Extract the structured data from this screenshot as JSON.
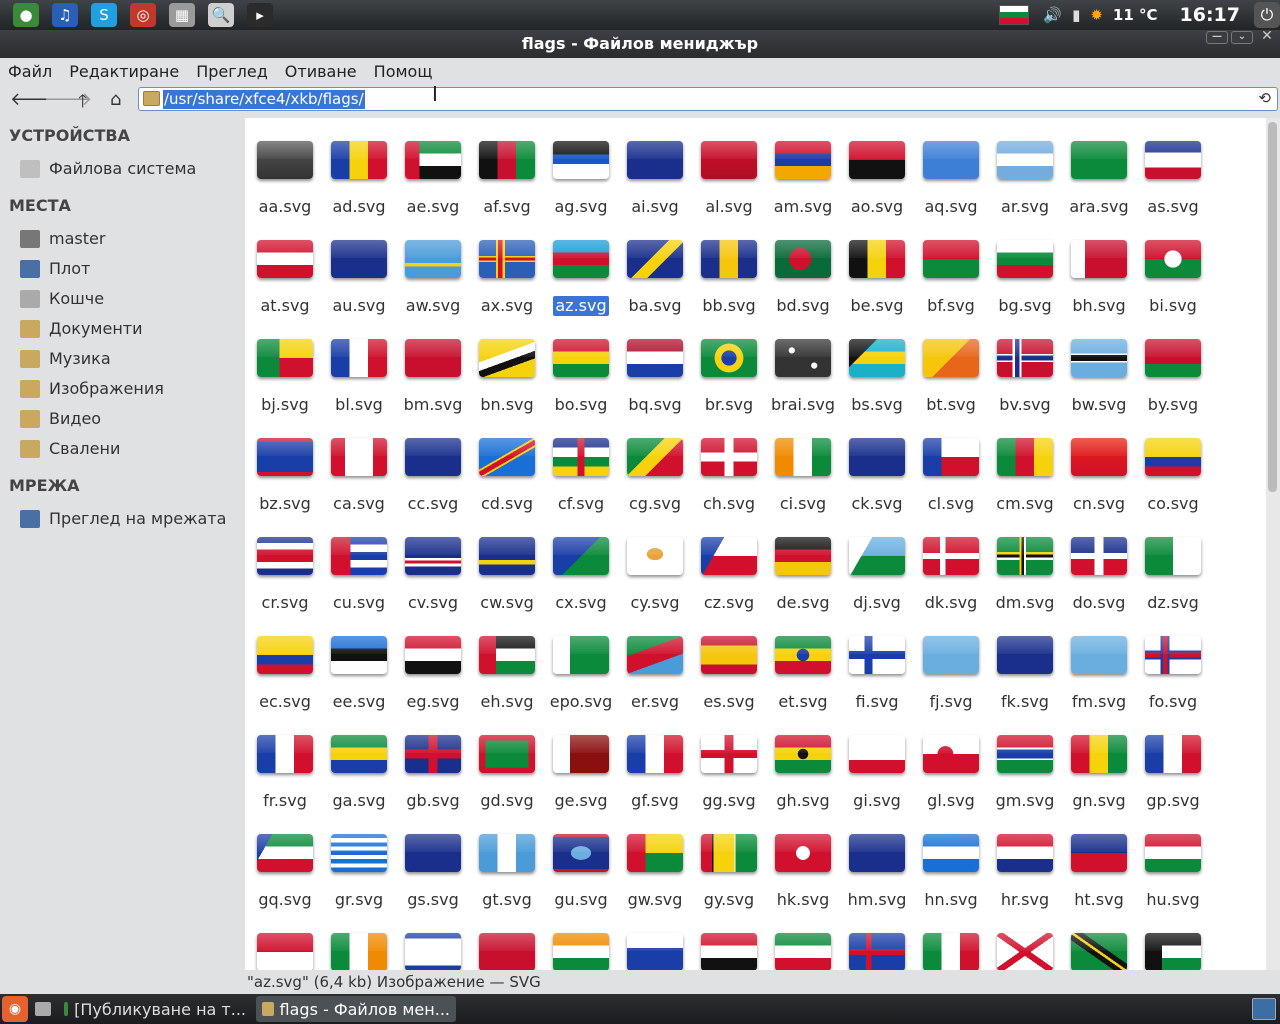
{
  "window": {
    "title": "flags - Файлов мениджър"
  },
  "top_panel": {
    "launchers": [
      {
        "icon": "chrome-icon",
        "color": "#3a8a3a",
        "glyph": "●"
      },
      {
        "icon": "music-player-icon",
        "color": "#2a5fb8",
        "glyph": "♫"
      },
      {
        "icon": "skype-icon",
        "color": "#1ea0e3",
        "glyph": "S"
      },
      {
        "icon": "disc-burner-icon",
        "color": "#c0392b",
        "glyph": "◎"
      },
      {
        "icon": "calculator-icon",
        "color": "#9a9a9a",
        "glyph": "▦"
      },
      {
        "icon": "search-tool-icon",
        "color": "#cfcfcf",
        "glyph": "🔍"
      },
      {
        "icon": "terminal-icon",
        "color": "#2b2b2b",
        "glyph": "▸"
      }
    ],
    "temperature": "11 °C",
    "clock": "16:17"
  },
  "menu": {
    "items": [
      "Файл",
      "Редактиране",
      "Преглед",
      "Отиване",
      "Помощ"
    ]
  },
  "location": {
    "path": "/usr/share/xfce4/xkb/flags/"
  },
  "sidebar": {
    "sections": [
      {
        "title": "УСТРОЙСТВА",
        "items": [
          {
            "label": "Файлова система",
            "icon": "drive-icon",
            "color": "#bfbfbf"
          }
        ]
      },
      {
        "title": "МЕСТА",
        "items": [
          {
            "label": "master",
            "icon": "home-icon",
            "color": "#777"
          },
          {
            "label": "Плот",
            "icon": "desktop-icon",
            "color": "#4a6fa5"
          },
          {
            "label": "Кошче",
            "icon": "trash-icon",
            "color": "#aaa"
          },
          {
            "label": "Документи",
            "icon": "folder-documents-icon",
            "color": "#c9a85f"
          },
          {
            "label": "Музика",
            "icon": "folder-music-icon",
            "color": "#c9a85f"
          },
          {
            "label": "Изображения",
            "icon": "folder-pictures-icon",
            "color": "#c9a85f"
          },
          {
            "label": "Видео",
            "icon": "folder-videos-icon",
            "color": "#c9a85f"
          },
          {
            "label": "Свалени",
            "icon": "folder-downloads-icon",
            "color": "#c9a85f"
          }
        ]
      },
      {
        "title": "МРЕЖА",
        "items": [
          {
            "label": "Преглед на мрежата",
            "icon": "network-icon",
            "color": "#4a6fa5"
          }
        ]
      }
    ]
  },
  "files": [
    {
      "name": "aa.svg",
      "flag": "linear-gradient(#555,#333)"
    },
    {
      "name": "ad.svg",
      "flag": "linear-gradient(90deg,#1a3ea8 33%,#f5d20b 33% 66%,#d0102c 66%)"
    },
    {
      "name": "ae.svg",
      "flag": "linear-gradient(90deg,#d0102c 26%,transparent 26%),linear-gradient(#0a8a3a 33%,#fff 33% 66%,#111 66%)"
    },
    {
      "name": "af.svg",
      "flag": "linear-gradient(90deg,#111 33%,#c8102e 33% 66%,#0a8a3a 66%)"
    },
    {
      "name": "ag.svg",
      "flag": "linear-gradient(#111 35%,#1a56c8 35% 60%,#fff 60%)"
    },
    {
      "name": "ai.svg",
      "flag": "linear-gradient(#1a2f8c,#1a2f8c)"
    },
    {
      "name": "al.svg",
      "flag": "linear-gradient(#d0102c,#b00d24)"
    },
    {
      "name": "am.svg",
      "flag": "linear-gradient(#d0102c 33%,#1a3ea8 33% 66%,#f2a800 66%)"
    },
    {
      "name": "ao.svg",
      "flag": "linear-gradient(#d0102c 50%,#111 50%)"
    },
    {
      "name": "aq.svg",
      "flag": "linear-gradient(#3d7fd6,#3d7fd6)"
    },
    {
      "name": "ar.svg",
      "flag": "linear-gradient(#74acdf 33%,#fff 33% 66%,#74acdf 66%)"
    },
    {
      "name": "ara.svg",
      "flag": "linear-gradient(#0a8a3a,#0a8a3a)"
    },
    {
      "name": "as.svg",
      "flag": "linear-gradient(#1a2f8c 30%,#fff 30% 70%,#c8102e 70%)"
    },
    {
      "name": "at.svg",
      "flag": "linear-gradient(#d0102c 33%,#fff 33% 66%,#d0102c 66%)"
    },
    {
      "name": "au.svg",
      "flag": "linear-gradient(#1a2f8c,#1a2f8c)"
    },
    {
      "name": "aw.svg",
      "flag": "linear-gradient(#4a9bd8 60%,#f5d20b 60% 70%,#4a9bd8 70%)"
    },
    {
      "name": "ax.svg",
      "flag": "linear-gradient(90deg,transparent 30%,#f5d20b 30% 34%,#d0102c 34% 42%,#f5d20b 42% 46%,transparent 46%),linear-gradient(#2a5fb8 42%,#f5d20b 42% 46%,#d0102c 46% 54%,#f5d20b 54% 58%,#2a5fb8 58%)"
    },
    {
      "name": "az.svg",
      "flag": "linear-gradient(#1a9cd8 33%,#d0102c 33% 66%,#0a8a3a 66%)"
    },
    {
      "name": "ba.svg",
      "flag": "linear-gradient(135deg,#1a2f8c 45%,#f5d20b 45% 62%,#1a2f8c 62%)"
    },
    {
      "name": "bb.svg",
      "flag": "linear-gradient(90deg,#1a2f8c 33%,#f5c60b 33% 66%,#1a2f8c 66%)"
    },
    {
      "name": "bd.svg",
      "flag": "radial-gradient(circle at 45% 50%,#d0102c 30%,#0a6a3a 31%)"
    },
    {
      "name": "be.svg",
      "flag": "linear-gradient(90deg,#111 33%,#f5d20b 33% 66%,#d0102c 66%)"
    },
    {
      "name": "bf.svg",
      "flag": "linear-gradient(#d0102c 50%,#0a8a3a 50%)"
    },
    {
      "name": "bg.svg",
      "flag": "linear-gradient(#fff 33%,#0a8a3a 33% 66%,#d0102c 66%)"
    },
    {
      "name": "bh.svg",
      "flag": "linear-gradient(90deg,#fff 25%,#c8102e 25%)"
    },
    {
      "name": "bi.svg",
      "flag": "radial-gradient(circle,#fff 25%,transparent 26%),linear-gradient(#d0102c 50%,#0a8a3a 50%)"
    },
    {
      "name": "bj.svg",
      "flag": "linear-gradient(90deg,#0a8a3a 40%,transparent 40%),linear-gradient(#f5d20b 50%,#d0102c 50%)"
    },
    {
      "name": "bl.svg",
      "flag": "linear-gradient(90deg,#1a3ea8 33%,#fff 33% 66%,#d0102c 66%)"
    },
    {
      "name": "bm.svg",
      "flag": "linear-gradient(#c8102e,#c8102e)"
    },
    {
      "name": "bn.svg",
      "flag": "linear-gradient(160deg,#f5d20b 40%,#fff 40% 55%,#111 55% 68%,#f5d20b 68%)"
    },
    {
      "name": "bo.svg",
      "flag": "linear-gradient(#d0102c 33%,#f5d20b 33% 66%,#0a8a3a 66%)"
    },
    {
      "name": "bq.svg",
      "flag": "linear-gradient(#b0102c 33%,#fff 33% 66%,#1a3ea8 66%)"
    },
    {
      "name": "br.svg",
      "flag": "radial-gradient(circle,#1a3ea8 22%,#f5d20b 23% 42%,#0a8a3a 43%)"
    },
    {
      "name": "brai.svg",
      "flag": "radial-gradient(circle at 30% 30%,#fff 6%,transparent 7%),radial-gradient(circle at 70% 70%,#fff 6%,transparent 7%),linear-gradient(#333,#333)"
    },
    {
      "name": "bs.svg",
      "flag": "linear-gradient(135deg,#111 30%,transparent 30%),linear-gradient(#1ab0c8 33%,#f5d20b 33% 66%,#1ab0c8 66%)"
    },
    {
      "name": "bt.svg",
      "flag": "linear-gradient(135deg,#f5c60b 50%,#e8661a 50%)"
    },
    {
      "name": "bv.svg",
      "flag": "linear-gradient(90deg,transparent 28%,#fff 28% 32%,#1a2f8c 32% 40%,#fff 40% 44%,transparent 44%),linear-gradient(#c8102e 40%,#fff 40% 44%,#1a2f8c 44% 56%,#fff 56% 60%,#c8102e 60%)"
    },
    {
      "name": "bw.svg",
      "flag": "linear-gradient(#6aaee0 38%,#fff 38% 42%,#111 42% 58%,#fff 58% 62%,#6aaee0 62%)"
    },
    {
      "name": "by.svg",
      "flag": "linear-gradient(#c8102e 66%,#0a8a3a 66%)"
    },
    {
      "name": "bz.svg",
      "flag": "linear-gradient(#d0102c 10%,#1a3ea8 10% 90%,#d0102c 90%)"
    },
    {
      "name": "ca.svg",
      "flag": "linear-gradient(90deg,#d0102c 25%,#fff 25% 75%,#d0102c 75%)"
    },
    {
      "name": "cc.svg",
      "flag": "linear-gradient(#1a2f8c,#1a2f8c)"
    },
    {
      "name": "cd.svg",
      "flag": "linear-gradient(150deg,#1a6fd6 45%,#f5d20b 45% 48%,#d0102c 48% 56%,#f5d20b 56% 59%,#1a6fd6 59%)"
    },
    {
      "name": "cf.svg",
      "flag": "linear-gradient(90deg,transparent 44%,#d0102c 44% 56%,transparent 56%),linear-gradient(#1a2f8c 25%,#fff 25% 50%,#0a8a3a 50% 75%,#f5d20b 75%)"
    },
    {
      "name": "cg.svg",
      "flag": "linear-gradient(135deg,#0a8a3a 40%,#f5d20b 40% 60%,#d0102c 60%)"
    },
    {
      "name": "ch.svg",
      "flag": "linear-gradient(90deg,transparent 42%,#fff 42% 58%,transparent 58%),linear-gradient(transparent 38%,#fff 38% 62%,transparent 62%),linear-gradient(#d0102c,#d0102c)"
    },
    {
      "name": "ci.svg",
      "flag": "linear-gradient(90deg,#f08a00 33%,#fff 33% 66%,#0a8a3a 66%)"
    },
    {
      "name": "ck.svg",
      "flag": "linear-gradient(#1a2f8c,#1a2f8c)"
    },
    {
      "name": "cl.svg",
      "flag": "linear-gradient(90deg,#1a3ea8 33%,transparent 33%),linear-gradient(#fff 50%,#d0102c 50%)"
    },
    {
      "name": "cm.svg",
      "flag": "linear-gradient(90deg,#0a8a3a 33%,#d0102c 33% 66%,#f5d20b 66%)"
    },
    {
      "name": "cn.svg",
      "flag": "linear-gradient(#e8200e,#d0102c)"
    },
    {
      "name": "co.svg",
      "flag": "linear-gradient(#f5d20b 50%,#1a3ea8 50% 75%,#d0102c 75%)"
    },
    {
      "name": "cr.svg",
      "flag": "linear-gradient(#1a2f8c 16%,#fff 16% 33%,#d0102c 33% 66%,#fff 66% 83%,#1a2f8c 83%)"
    },
    {
      "name": "cu.svg",
      "flag": "linear-gradient(90deg,#d0102c 35%,transparent 35%),linear-gradient(#1a3ea8 20%,#fff 20% 40%,#1a3ea8 40% 60%,#fff 60% 80%,#1a3ea8 80%)"
    },
    {
      "name": "cv.svg",
      "flag": "linear-gradient(#1a2f8c 55%,#fff 55% 62%,#d0102c 62% 70%,#fff 70% 77%,#1a2f8c 77%)"
    },
    {
      "name": "cw.svg",
      "flag": "linear-gradient(#1a2f8c 60%,#f5d20b 60% 72%,#1a2f8c 72%)"
    },
    {
      "name": "cx.svg",
      "flag": "linear-gradient(135deg,#1a3ea8 50%,#0a8a3a 50%)"
    },
    {
      "name": "cy.svg",
      "flag": "radial-gradient(ellipse at 50% 45%,#e8a43a 20%,#fff 21%)"
    },
    {
      "name": "cz.svg",
      "flag": "linear-gradient(120deg,#1a3ea8 30%,transparent 30%),linear-gradient(#fff 50%,#d0102c 50%)"
    },
    {
      "name": "de.svg",
      "flag": "linear-gradient(#111 33%,#d0102c 33% 66%,#f5c60b 66%)"
    },
    {
      "name": "dj.svg",
      "flag": "linear-gradient(120deg,#fff 30%,transparent 30%),linear-gradient(#6aaee0 50%,#0a8a3a 50%)"
    },
    {
      "name": "dk.svg",
      "flag": "linear-gradient(90deg,transparent 30%,#fff 30% 40%,transparent 40%),linear-gradient(transparent 42%,#fff 42% 58%,transparent 58%),linear-gradient(#d0102c,#d0102c)"
    },
    {
      "name": "dm.svg",
      "flag": "linear-gradient(90deg,transparent 40%,#f5d20b 40% 44%,#111 44% 48%,#fff 48% 52%,transparent 52%),linear-gradient(transparent 40%,#f5d20b 40% 46%,#111 46% 54%,#fff 54% 60%,transparent 60%),linear-gradient(#0a8a3a,#0a8a3a)"
    },
    {
      "name": "do.svg",
      "flag": "linear-gradient(90deg,transparent 42%,#fff 42% 58%,transparent 58%),linear-gradient(#1a2f8c 42%,#fff 42% 58%,#d0102c 58%)"
    },
    {
      "name": "dz.svg",
      "flag": "linear-gradient(90deg,#0a8a3a 50%,#fff 50%)"
    },
    {
      "name": "ec.svg",
      "flag": "linear-gradient(#f5d20b 50%,#1a3ea8 50% 75%,#d0102c 75%)"
    },
    {
      "name": "ee.svg",
      "flag": "linear-gradient(#1a6fd6 33%,#111 33% 66%,#fff 66%)"
    },
    {
      "name": "eg.svg",
      "flag": "linear-gradient(#d0102c 33%,#fff 33% 66%,#111 66%)"
    },
    {
      "name": "eh.svg",
      "flag": "linear-gradient(90deg,#d0102c 30%,transparent 30%),linear-gradient(#111 33%,#fff 33% 66%,#0a8a3a 66%)"
    },
    {
      "name": "epo.svg",
      "flag": "linear-gradient(90deg,#fff 30%,transparent 30%),linear-gradient(#0a8a3a,#0a8a3a)"
    },
    {
      "name": "er.svg",
      "flag": "linear-gradient(160deg,#0a8a3a 35%,#d0102c 35% 65%,#4a9bd8 65%)"
    },
    {
      "name": "es.svg",
      "flag": "linear-gradient(#c8102e 25%,#f5c60b 25% 75%,#c8102e 75%)"
    },
    {
      "name": "et.svg",
      "flag": "radial-gradient(circle,#1a3ea8 18%,transparent 19%),linear-gradient(#0a8a3a 33%,#f5d20b 33% 66%,#d0102c 66%)"
    },
    {
      "name": "fi.svg",
      "flag": "linear-gradient(90deg,transparent 28%,#1a3ea8 28% 42%,transparent 42%),linear-gradient(transparent 40%,#1a3ea8 40% 60%,transparent 60%),linear-gradient(#fff,#fff)"
    },
    {
      "name": "fj.svg",
      "flag": "linear-gradient(#6aaee0,#6aaee0)"
    },
    {
      "name": "fk.svg",
      "flag": "linear-gradient(#1a2f8c,#1a2f8c)"
    },
    {
      "name": "fm.svg",
      "flag": "linear-gradient(#6aaee0,#6aaee0)"
    },
    {
      "name": "fo.svg",
      "flag": "linear-gradient(90deg,transparent 28%,#1a3ea8 28% 32%,#d0102c 32% 40%,#1a3ea8 40% 44%,transparent 44%),linear-gradient(transparent 38%,#1a3ea8 38% 44%,#d0102c 44% 56%,#1a3ea8 56% 62%,transparent 62%),linear-gradient(#fff,#fff)"
    },
    {
      "name": "fr.svg",
      "flag": "linear-gradient(90deg,#1a3ea8 33%,#fff 33% 66%,#d0102c 66%)"
    },
    {
      "name": "ga.svg",
      "flag": "linear-gradient(#0a8a3a 33%,#f5d20b 33% 66%,#1a3ea8 66%)"
    },
    {
      "name": "gb.svg",
      "flag": "linear-gradient(90deg,transparent 42%,#d0102c 42% 58%,transparent 58%),linear-gradient(transparent 38%,#d0102c 38% 62%,transparent 62%),linear-gradient(#1a2f8c,#1a2f8c)"
    },
    {
      "name": "gd.svg",
      "flag": "linear-gradient(90deg,#d0102c 12%,transparent 12% 88%,#d0102c 88%),linear-gradient(#d0102c 14%,#0a8a3a 14% 86%,#d0102c 86%)"
    },
    {
      "name": "ge.svg",
      "flag": "linear-gradient(90deg,#fff 30%,transparent 30%),linear-gradient(#8a1010,#8a1010)"
    },
    {
      "name": "gf.svg",
      "flag": "linear-gradient(90deg,#1a3ea8 33%,#fff 33% 66%,#d0102c 66%)"
    },
    {
      "name": "gg.svg",
      "flag": "linear-gradient(90deg,transparent 42%,#d0102c 42% 58%,transparent 58%),linear-gradient(transparent 40%,#d0102c 40% 60%,transparent 60%),linear-gradient(#fff,#fff)"
    },
    {
      "name": "gh.svg",
      "flag": "radial-gradient(circle,#111 15%,transparent 16%),linear-gradient(#d0102c 33%,#f5d20b 33% 66%,#0a8a3a 66%)"
    },
    {
      "name": "gi.svg",
      "flag": "linear-gradient(#fff 66%,#d0102c 66%)"
    },
    {
      "name": "gl.svg",
      "flag": "radial-gradient(circle at 40% 50%,#d0102c 20%,transparent 21%),linear-gradient(#fff 50%,#d0102c 50%)"
    },
    {
      "name": "gm.svg",
      "flag": "linear-gradient(#d0102c 33%,#fff 33% 38%,#1a3ea8 38% 62%,#fff 62% 66%,#0a8a3a 66%)"
    },
    {
      "name": "gn.svg",
      "flag": "linear-gradient(90deg,#d0102c 33%,#f5d20b 33% 66%,#0a8a3a 66%)"
    },
    {
      "name": "gp.svg",
      "flag": "linear-gradient(90deg,#1a3ea8 33%,#fff 33% 66%,#d0102c 66%)"
    },
    {
      "name": "gq.svg",
      "flag": "linear-gradient(120deg,#1a3ea8 20%,transparent 20%),linear-gradient(#0a8a3a 33%,#fff 33% 66%,#d0102c 66%)"
    },
    {
      "name": "gr.svg",
      "flag": "linear-gradient(#1a6fd6 11%,#fff 11% 22%,#1a6fd6 22% 33%,#fff 33% 44%,#1a6fd6 44% 55%,#fff 55% 66%,#1a6fd6 66% 77%,#fff 77% 88%,#1a6fd6 88%)"
    },
    {
      "name": "gs.svg",
      "flag": "linear-gradient(#1a2f8c,#1a2f8c)"
    },
    {
      "name": "gt.svg",
      "flag": "linear-gradient(90deg,#4a9bd8 33%,#fff 33% 66%,#4a9bd8 66%)"
    },
    {
      "name": "gu.svg",
      "flag": "radial-gradient(ellipse,#6aaee0 25%,transparent 26%),linear-gradient(#c8102e 8%,#1a2f8c 8% 92%,#c8102e 92%)"
    },
    {
      "name": "gw.svg",
      "flag": "linear-gradient(90deg,#d0102c 33%,transparent 33%),linear-gradient(#f5d20b 50%,#0a8a3a 50%)"
    },
    {
      "name": "gy.svg",
      "flag": "linear-gradient(90deg,#d0102c 20%,#111 20% 22%,#f5d20b 22% 60%,#fff 60% 62%,#0a8a3a 62%)"
    },
    {
      "name": "hk.svg",
      "flag": "radial-gradient(circle,#fff 20%,#d0102c 21%)"
    },
    {
      "name": "hm.svg",
      "flag": "linear-gradient(#1a2f8c,#1a2f8c)"
    },
    {
      "name": "hn.svg",
      "flag": "linear-gradient(#1a6fd6 33%,#fff 33% 66%,#1a6fd6 66%)"
    },
    {
      "name": "hr.svg",
      "flag": "linear-gradient(#d0102c 33%,#fff 33% 66%,#1a2f8c 66%)"
    },
    {
      "name": "ht.svg",
      "flag": "linear-gradient(#1a2f8c 50%,#d0102c 50%)"
    },
    {
      "name": "hu.svg",
      "flag": "linear-gradient(#d0102c 33%,#fff 33% 66%,#0a8a3a 66%)"
    },
    {
      "name": "",
      "flag": "linear-gradient(#d0102c 50%,#fff 50%)"
    },
    {
      "name": "",
      "flag": "linear-gradient(90deg,#0a8a3a 33%,#fff 33% 66%,#f08a00 66%)"
    },
    {
      "name": "",
      "flag": "linear-gradient(#1a3ea8 15%,#fff 15% 85%,#1a3ea8 85%)"
    },
    {
      "name": "",
      "flag": "linear-gradient(#c8102e,#c8102e)"
    },
    {
      "name": "",
      "flag": "linear-gradient(#f08a00 33%,#fff 33% 66%,#0a8a3a 66%)"
    },
    {
      "name": "",
      "flag": "linear-gradient(#fff 40%,#1a3ea8 40%)"
    },
    {
      "name": "",
      "flag": "linear-gradient(#d0102c 33%,#fff 33% 66%,#111 66%)"
    },
    {
      "name": "",
      "flag": "linear-gradient(#0a8a3a 33%,#fff 33% 66%,#d0102c 66%)"
    },
    {
      "name": "",
      "flag": "linear-gradient(90deg,transparent 30%,#d0102c 30% 40%,transparent 40%),linear-gradient(transparent 42%,#d0102c 42% 58%,transparent 58%),linear-gradient(#1a3ea8,#1a3ea8)"
    },
    {
      "name": "",
      "flag": "linear-gradient(90deg,#0a8a3a 33%,#fff 33% 66%,#d0102c 66%)"
    },
    {
      "name": "",
      "flag": "linear-gradient(35deg,transparent 45%,#d0102c 45% 55%,transparent 55%),linear-gradient(145deg,#fff 45%,#d0102c 45% 55%,#fff 55%)"
    },
    {
      "name": "",
      "flag": "linear-gradient(35deg,#0a8a3a 40%,#111 40% 48%,#f5d20b 48% 52%,#111 52% 60%,#0a8a3a 60%)"
    },
    {
      "name": "",
      "flag": "linear-gradient(90deg,#111 30%,transparent 30%),linear-gradient(#111 33%,#fff 33% 66%,#0a8a3a 66%)"
    }
  ],
  "selected_file": "az.svg",
  "status": {
    "text": "\"az.svg\" (6,4 kb) Изображение — SVG"
  },
  "taskbar": {
    "tasks": [
      {
        "label": "[Публикуване на т...",
        "icon": "chrome-icon",
        "active": false
      },
      {
        "label": "flags - Файлов мен...",
        "icon": "folder-icon",
        "active": true
      }
    ]
  }
}
